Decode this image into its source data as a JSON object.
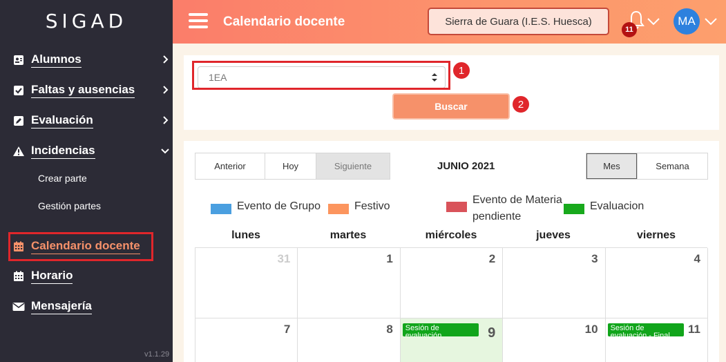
{
  "app": {
    "logo": "SIGAD",
    "version": "v1.1.29"
  },
  "sidebar": {
    "items": [
      {
        "label": "Alumnos",
        "icon": "student-card-icon"
      },
      {
        "label": "Faltas y ausencias",
        "icon": "checkbox-icon"
      },
      {
        "label": "Evaluación",
        "icon": "edit-icon"
      },
      {
        "label": "Incidencias",
        "icon": "warning-icon"
      },
      {
        "label": "Calendario docente",
        "icon": "calendar-icon"
      },
      {
        "label": "Horario",
        "icon": "calendar-icon"
      },
      {
        "label": "Mensajería",
        "icon": "envelope-icon"
      }
    ],
    "subitems": [
      {
        "label": "Crear parte"
      },
      {
        "label": "Gestión partes"
      }
    ]
  },
  "header": {
    "title": "Calendario docente",
    "school": "Sierra de Guara (I.E.S. Huesca)",
    "notifications_count": "11",
    "avatar_initials": "MA"
  },
  "filter": {
    "group_selected": "1EA",
    "search_label": "Buscar",
    "step1": "1",
    "step2": "2"
  },
  "calendar": {
    "nav": {
      "prev": "Anterior",
      "today": "Hoy",
      "next": "Siguiente"
    },
    "title": "JUNIO 2021",
    "views": {
      "month": "Mes",
      "week": "Semana"
    },
    "legend": [
      {
        "label": "Evento de Grupo",
        "color": "#4a9fe0"
      },
      {
        "label": "Festivo",
        "color": "#fc955e"
      },
      {
        "label": "Evento de Materia pendiente",
        "color": "#d9535a"
      },
      {
        "label": "Evaluacion",
        "color": "#18a91c"
      }
    ],
    "weekdays": [
      "lunes",
      "martes",
      "miércoles",
      "jueves",
      "viernes"
    ],
    "weeks": [
      [
        "31",
        "1",
        "2",
        "3",
        "4"
      ],
      [
        "7",
        "8",
        "9",
        "10",
        "11"
      ]
    ],
    "events": [
      {
        "text": "Sesión de evaluación",
        "day": "9"
      },
      {
        "text": "Sesión de evaluación - Final",
        "day": "11"
      }
    ]
  }
}
